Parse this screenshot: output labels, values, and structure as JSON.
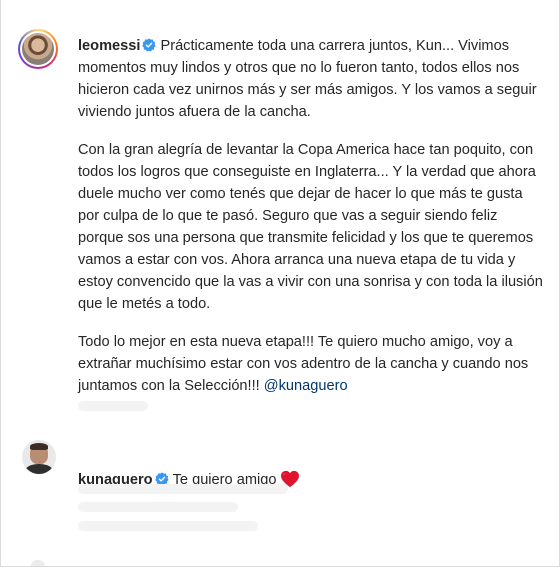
{
  "comment": {
    "username": "leomessi",
    "paragraphs": [
      "Prácticamente toda una carrera juntos, Kun... Vivimos momentos muy lindos y otros que no lo fueron tanto, todos ellos nos hicieron cada vez unirnos más y ser más amigos. Y los vamos a seguir viviendo juntos afuera de la cancha.",
      "Con la gran alegría de levantar la Copa America hace tan poquito, con todos los logros que conseguiste en Inglaterra... Y la verdad que ahora duele mucho ver como tenés que dejar de hacer lo que más te gusta por culpa de lo que te pasó. Seguro que vas a seguir siendo feliz porque sos una persona que transmite felicidad y los que te queremos vamos a estar con vos. Ahora arranca una nueva etapa de tu vida y estoy convencido que la vas a vivir con una sonrisa y con toda la ilusión que le metés a todo.",
      "Todo lo mejor en esta nueva etapa!!! Te quiero mucho amigo, voy a extrañar muchísimo estar con vos adentro de la cancha y cuando nos juntamos con la Selección!!!"
    ],
    "mention": "@kunaguero"
  },
  "reply": {
    "username": "kunaguero",
    "text": "Te quiero amigo"
  },
  "icons": {
    "verified": "verified-badge-icon",
    "heart": "red-heart-emoji"
  },
  "colors": {
    "verified_blue": "#3897f0",
    "heart_red": "#e0142b",
    "mention_blue": "#00376b"
  }
}
